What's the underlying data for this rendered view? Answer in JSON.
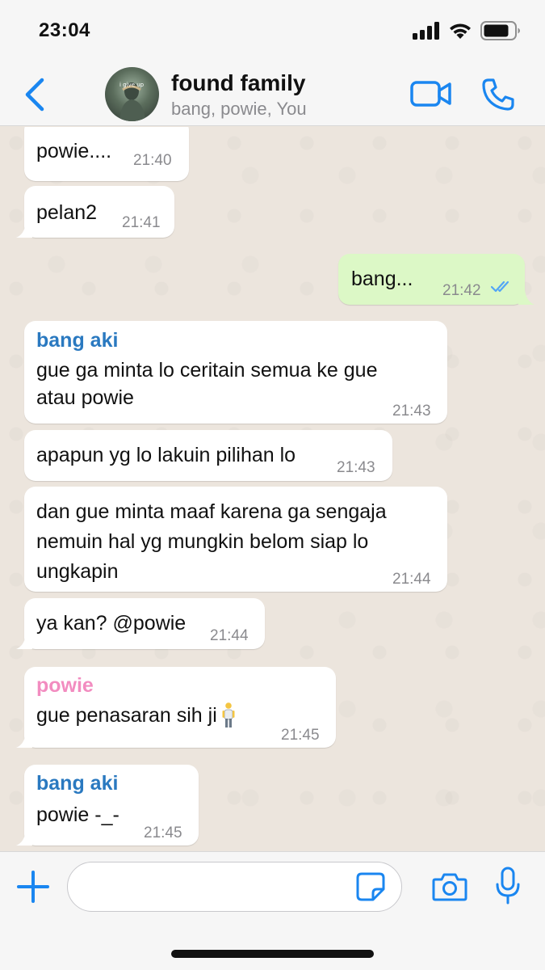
{
  "status_bar": {
    "time": "23:04"
  },
  "header": {
    "title": "found family",
    "subtitle": "bang, powie, You",
    "avatar_text": "i give up"
  },
  "colors": {
    "accent": "#1a86f0",
    "sender_bang": "#2a79c0",
    "sender_powie": "#f28cc0",
    "outgoing_bubble": "#dcf8c6",
    "read_ticks": "#53a6f5"
  },
  "messages": [
    {
      "direction": "in",
      "text": "powie....",
      "time": "21:40"
    },
    {
      "direction": "in",
      "text": "pelan2",
      "time": "21:41"
    },
    {
      "direction": "out",
      "text": "bang...",
      "time": "21:42",
      "status": "read"
    },
    {
      "direction": "in",
      "sender": "bang aki",
      "text": "gue ga minta lo ceritain semua ke gue\natau powie",
      "time": "21:43"
    },
    {
      "direction": "in",
      "text": "apapun yg lo lakuin pilihan lo",
      "time": "21:43"
    },
    {
      "direction": "in",
      "text": "dan gue minta maaf karena ga sengaja\nnemuin hal yg mungkin belom siap lo\nungkapin",
      "time": "21:44"
    },
    {
      "direction": "in",
      "text": "ya kan? @powie",
      "time": "21:44"
    },
    {
      "direction": "in",
      "sender": "powie",
      "text": "gue penasaran sih ji",
      "emoji": "standing-person",
      "time": "21:45"
    },
    {
      "direction": "in",
      "sender": "bang aki",
      "text": "powie -_-",
      "time": "21:45"
    }
  ],
  "input": {
    "placeholder": "",
    "value": ""
  }
}
